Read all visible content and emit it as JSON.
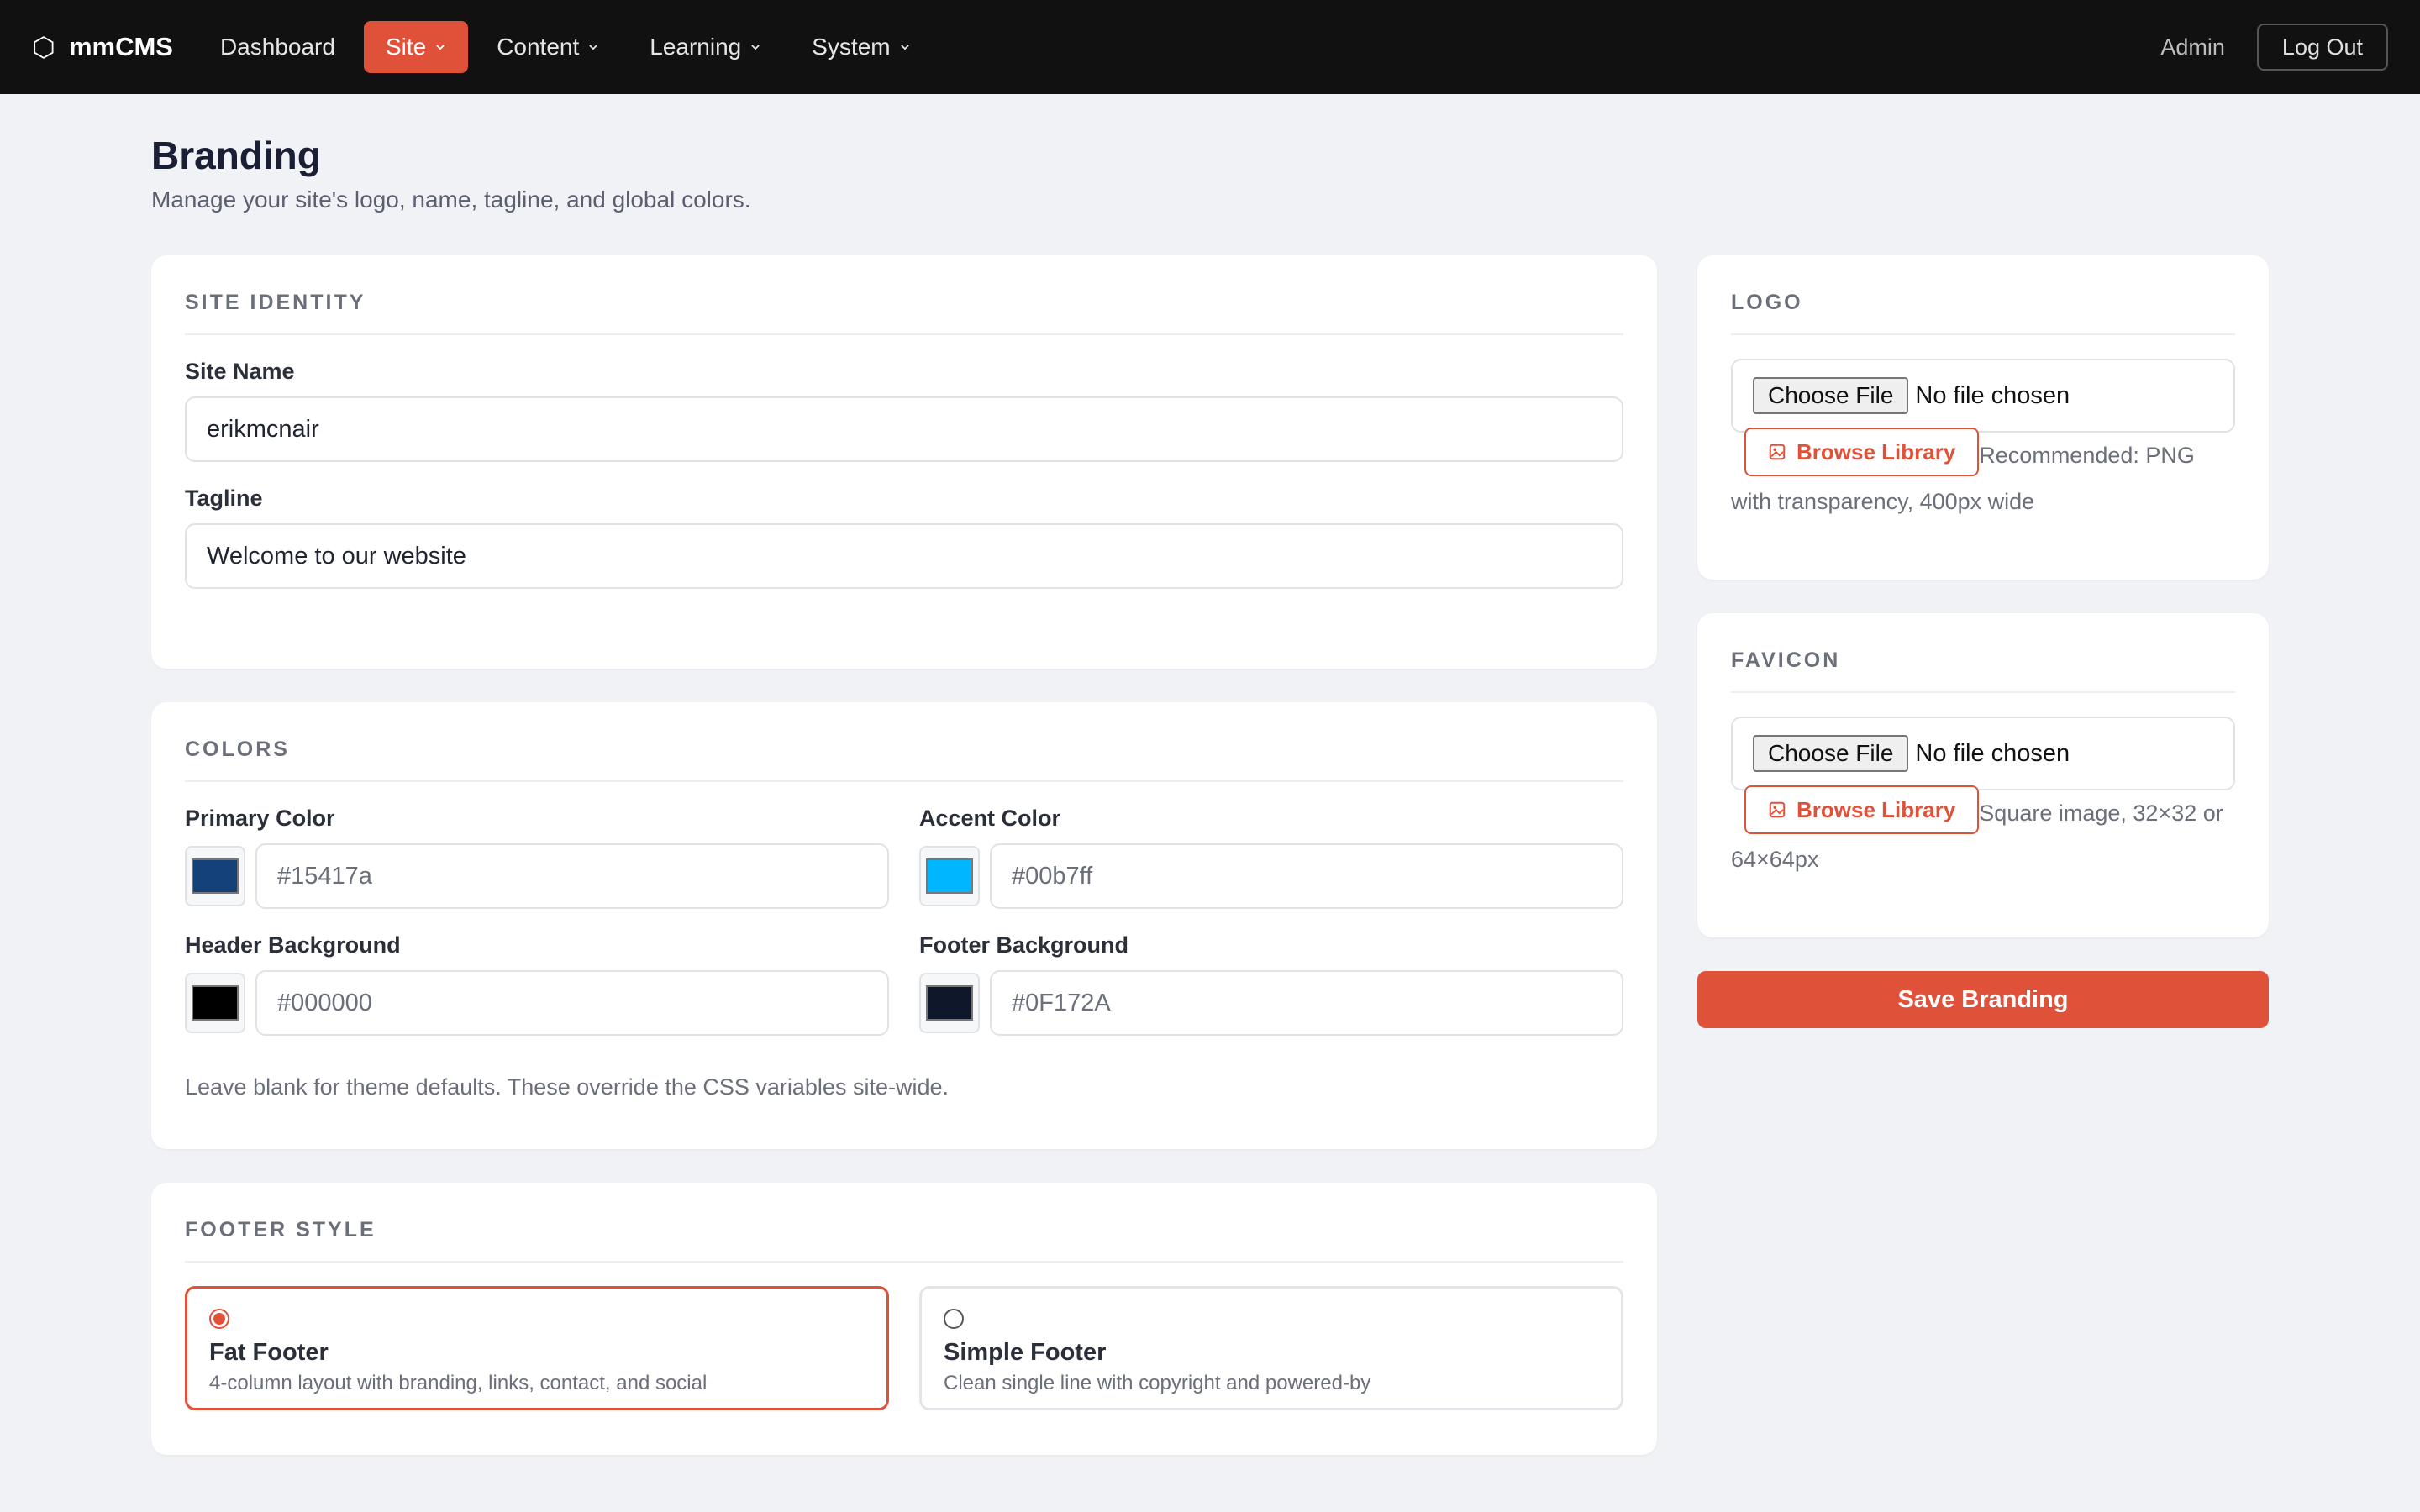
{
  "nav": {
    "brand": "mmCMS",
    "items": [
      {
        "label": "Dashboard",
        "dropdown": false,
        "active": false
      },
      {
        "label": "Site",
        "dropdown": true,
        "active": true
      },
      {
        "label": "Content",
        "dropdown": true,
        "active": false
      },
      {
        "label": "Learning",
        "dropdown": true,
        "active": false
      },
      {
        "label": "System",
        "dropdown": true,
        "active": false
      }
    ],
    "user": "Admin",
    "logout_label": "Log Out"
  },
  "page": {
    "title": "Branding",
    "subtitle": "Manage your site's logo, name, tagline, and global colors."
  },
  "identity": {
    "section_title": "SITE IDENTITY",
    "site_name_label": "Site Name",
    "site_name_value": "erikmcnair",
    "tagline_label": "Tagline",
    "tagline_value": "Welcome to our website"
  },
  "colors": {
    "section_title": "COLORS",
    "primary": {
      "label": "Primary Color",
      "placeholder": "#15417a",
      "swatch": "#15417a"
    },
    "accent": {
      "label": "Accent Color",
      "placeholder": "#00b7ff",
      "swatch": "#00b7ff"
    },
    "header_bg": {
      "label": "Header Background",
      "placeholder": "#000000",
      "swatch": "#000000"
    },
    "footer_bg": {
      "label": "Footer Background",
      "placeholder": "#0F172A",
      "swatch": "#0F172A"
    },
    "hint": "Leave blank for theme defaults. These override the CSS variables site-wide."
  },
  "footer_style": {
    "section_title": "FOOTER STYLE",
    "options": [
      {
        "title": "Fat Footer",
        "desc": "4-column layout with branding, links, contact, and social",
        "selected": true
      },
      {
        "title": "Simple Footer",
        "desc": "Clean single line with copyright and powered-by",
        "selected": false
      }
    ]
  },
  "logo": {
    "section_title": "LOGO",
    "choose_label": "Choose File",
    "file_status": "No file chosen",
    "browse_label": "Browse Library",
    "hint": "Recommended: PNG with transparency, 400px wide"
  },
  "favicon": {
    "section_title": "FAVICON",
    "choose_label": "Choose File",
    "file_status": "No file chosen",
    "browse_label": "Browse Library",
    "hint": "Square image, 32×32 or 64×64px"
  },
  "save_label": "Save Branding",
  "theme": {
    "accent": "#e0513a",
    "nav_bg": "#111111",
    "page_bg": "#f1f2f5"
  }
}
